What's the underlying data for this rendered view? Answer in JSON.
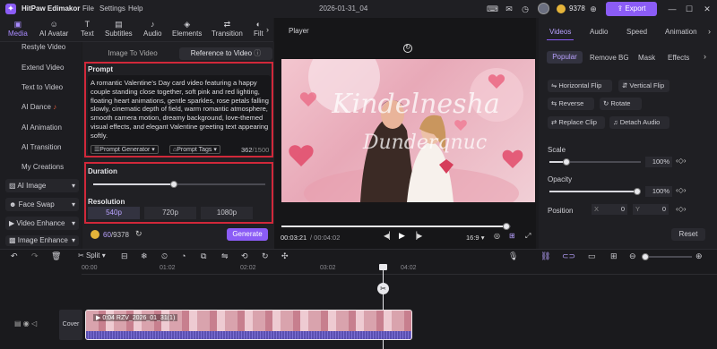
{
  "app": {
    "name": "HitPaw Edimakor",
    "menu": [
      "File",
      "Settings",
      "Help"
    ],
    "doc_title": "2026-01-31_04",
    "credits": "9378",
    "export_label": "Export"
  },
  "toolbar": [
    {
      "label": "Media",
      "icon": "media-icon"
    },
    {
      "label": "AI Avatar",
      "icon": "ai-avatar-icon"
    },
    {
      "label": "Text",
      "icon": "text-icon"
    },
    {
      "label": "Subtitles",
      "icon": "subtitles-icon"
    },
    {
      "label": "Audio",
      "icon": "audio-icon"
    },
    {
      "label": "Elements",
      "icon": "elements-icon"
    },
    {
      "label": "Transition",
      "icon": "transition-icon"
    },
    {
      "label": "Filt",
      "icon": "filter-icon"
    }
  ],
  "sidebar": {
    "items": [
      "Restyle Video",
      "Extend Video",
      "Text to Video",
      "AI Dance",
      "AI Animation",
      "AI Transition",
      "My Creations"
    ],
    "buttons": [
      "AI Image",
      "Face Swap",
      "Video Enhance",
      "Image Enhance"
    ]
  },
  "panel": {
    "tab_image": "Image To Video",
    "tab_reference": "Reference to Video",
    "prompt_label": "Prompt",
    "prompt_text": "A romantic Valentine’s Day card video featuring a happy couple standing close together, soft pink and red lighting, floating heart animations, gentle sparkles, rose petals falling slowly, cinematic depth of field, warm romantic atmosphere, smooth camera motion, dreamy background, love-themed visual effects, and elegant Valentine greeting text appearing softly.",
    "prompt_generator": "Prompt Generator",
    "prompt_tags": "Prompt Tags",
    "char_count": "362",
    "char_max": "/1500",
    "duration_label": "Duration",
    "duration_value": 0.47,
    "resolution_label": "Resolution",
    "resolutions": [
      "540p",
      "720p",
      "1080p"
    ],
    "cost": "60",
    "cost_total": "/9378",
    "generate": "Generate"
  },
  "player": {
    "title": "Player",
    "time_current": "00:03:21",
    "time_total": "/ 00:04:02",
    "ratio": "16:9",
    "progress": 0.98
  },
  "right": {
    "tabs": [
      "Videos",
      "Audio",
      "Speed",
      "Animation"
    ],
    "subtabs": [
      "Popular",
      "Remove BG",
      "Mask",
      "Effects"
    ],
    "buttons": [
      "Horizontal Flip",
      "Vertical Flip",
      "Reverse",
      "Rotate",
      "Replace Clip",
      "Detach Audio"
    ],
    "scale_label": "Scale",
    "scale_value": "100%",
    "opacity_label": "Opacity",
    "opacity_value": "100%",
    "position_label": "Position",
    "pos_x_label": "X",
    "pos_x": "0",
    "pos_y_label": "Y",
    "pos_y": "0",
    "reset": "Reset"
  },
  "timeline": {
    "split": "Split",
    "ruler": [
      "00:00",
      "01:02",
      "02:02",
      "03:02",
      "04:02"
    ],
    "cover": "Cover",
    "clip_name": "0:04 RZV_2026_01_31(1)",
    "clip_time": "0:04"
  }
}
